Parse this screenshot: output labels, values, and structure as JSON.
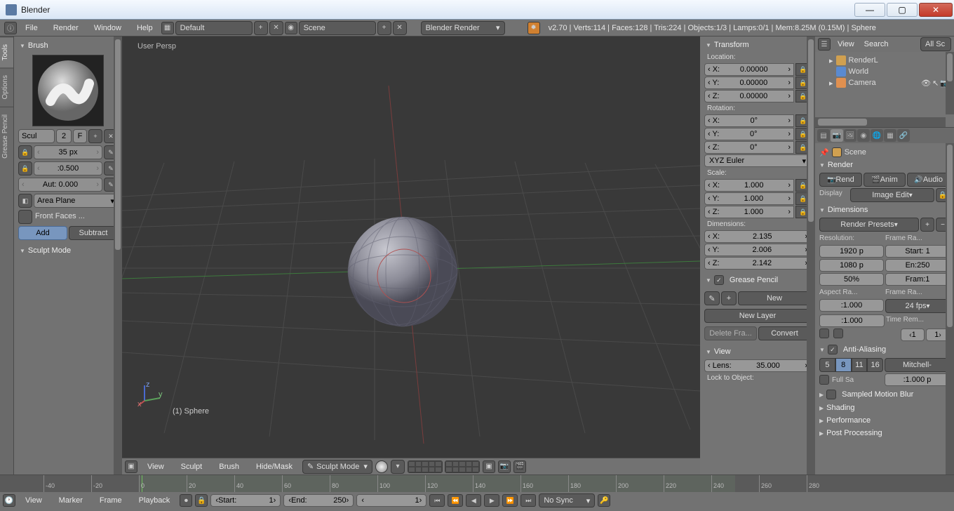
{
  "window": {
    "title": "Blender"
  },
  "menubar": {
    "items": [
      "File",
      "Render",
      "Window",
      "Help"
    ],
    "layout": "Default",
    "scene": "Scene",
    "engine": "Blender Render",
    "stats": "v2.70 | Verts:114 | Faces:128 | Tris:224 | Objects:1/3 | Lamps:0/1 | Mem:8.25M (0.15M) | Sphere"
  },
  "left": {
    "tabs": [
      "Tools",
      "Options",
      "Grease Pencil"
    ],
    "brush_header": "Brush",
    "brush_name": "Scul",
    "brush_users": "2",
    "brush_fake": "F",
    "radius": "35 px",
    "strength": ":0.500",
    "autosmooth": "Aut: 0.000",
    "plane": "Area Plane",
    "front_faces": "Front Faces ...",
    "add": "Add",
    "subtract": "Subtract",
    "sculpt_mode_hdr": "Sculpt Mode"
  },
  "viewport": {
    "persp": "User Persp",
    "object": "(1) Sphere",
    "header": {
      "menus": [
        "View",
        "Sculpt",
        "Brush",
        "Hide/Mask"
      ],
      "mode": "Sculpt Mode"
    }
  },
  "npanel": {
    "transform": "Transform",
    "location": "Location:",
    "loc": {
      "x": "0.00000",
      "y": "0.00000",
      "z": "0.00000"
    },
    "rotation": "Rotation:",
    "rot": {
      "x": "0°",
      "y": "0°",
      "z": "0°"
    },
    "rot_mode": "XYZ Euler",
    "scale": "Scale:",
    "scl": {
      "x": "1.000",
      "y": "1.000",
      "z": "1.000"
    },
    "dimensions": "Dimensions:",
    "dim": {
      "x": "2.135",
      "y": "2.006",
      "z": "2.142"
    },
    "grease": "Grease Pencil",
    "gp_new": "New",
    "gp_layer": "New Layer",
    "gp_del": "Delete Fra...",
    "gp_conv": "Convert",
    "view": "View",
    "lens": "Lens:",
    "lens_v": "35.000",
    "lock": "Lock to Object:"
  },
  "outliner": {
    "menus": [
      "View",
      "Search"
    ],
    "filter": "All Sc",
    "items": [
      "RenderL",
      "World",
      "Camera"
    ]
  },
  "props": {
    "scene_path": "Scene",
    "render": "Render",
    "render_btns": [
      "Rend",
      "Anim",
      "Audio"
    ],
    "display": "Display",
    "display_v": "Image Edit",
    "dims": "Dimensions",
    "presets": "Render Presets",
    "res_lbl": "Resolution:",
    "frame_range_lbl": "Frame Ra...",
    "res_x": "1920 p",
    "res_y": "1080 p",
    "res_pct": "50%",
    "fr_start": "Start: 1",
    "fr_end": "En:250",
    "fr_step": "Fram:1",
    "aspect_lbl": "Aspect Ra...",
    "framerate_lbl": "Frame Ra...",
    "asp_x": ":1.000",
    "asp_y": ":1.000",
    "fps": "24 fps",
    "time_rem": "Time Rem...",
    "old": "1",
    "aa": "Anti-Aliasing",
    "aa_samples": [
      "5",
      "8",
      "11",
      "16"
    ],
    "aa_filter": "Mitchell-",
    "aa_full": "Full Sa",
    "aa_px": ":1.000 p",
    "motion_blur": "Sampled Motion Blur",
    "shading": "Shading",
    "performance": "Performance",
    "post": "Post Processing"
  },
  "timeline": {
    "menus": [
      "View",
      "Marker",
      "Frame",
      "Playback"
    ],
    "start_lbl": "Start:",
    "start": "1",
    "end_lbl": "End:",
    "end": "250",
    "current": "1",
    "sync": "No Sync",
    "ticks": [
      "-40",
      "-20",
      "0",
      "20",
      "40",
      "60",
      "80",
      "100",
      "120",
      "140",
      "160",
      "180",
      "200",
      "220",
      "240",
      "260",
      "280"
    ]
  }
}
